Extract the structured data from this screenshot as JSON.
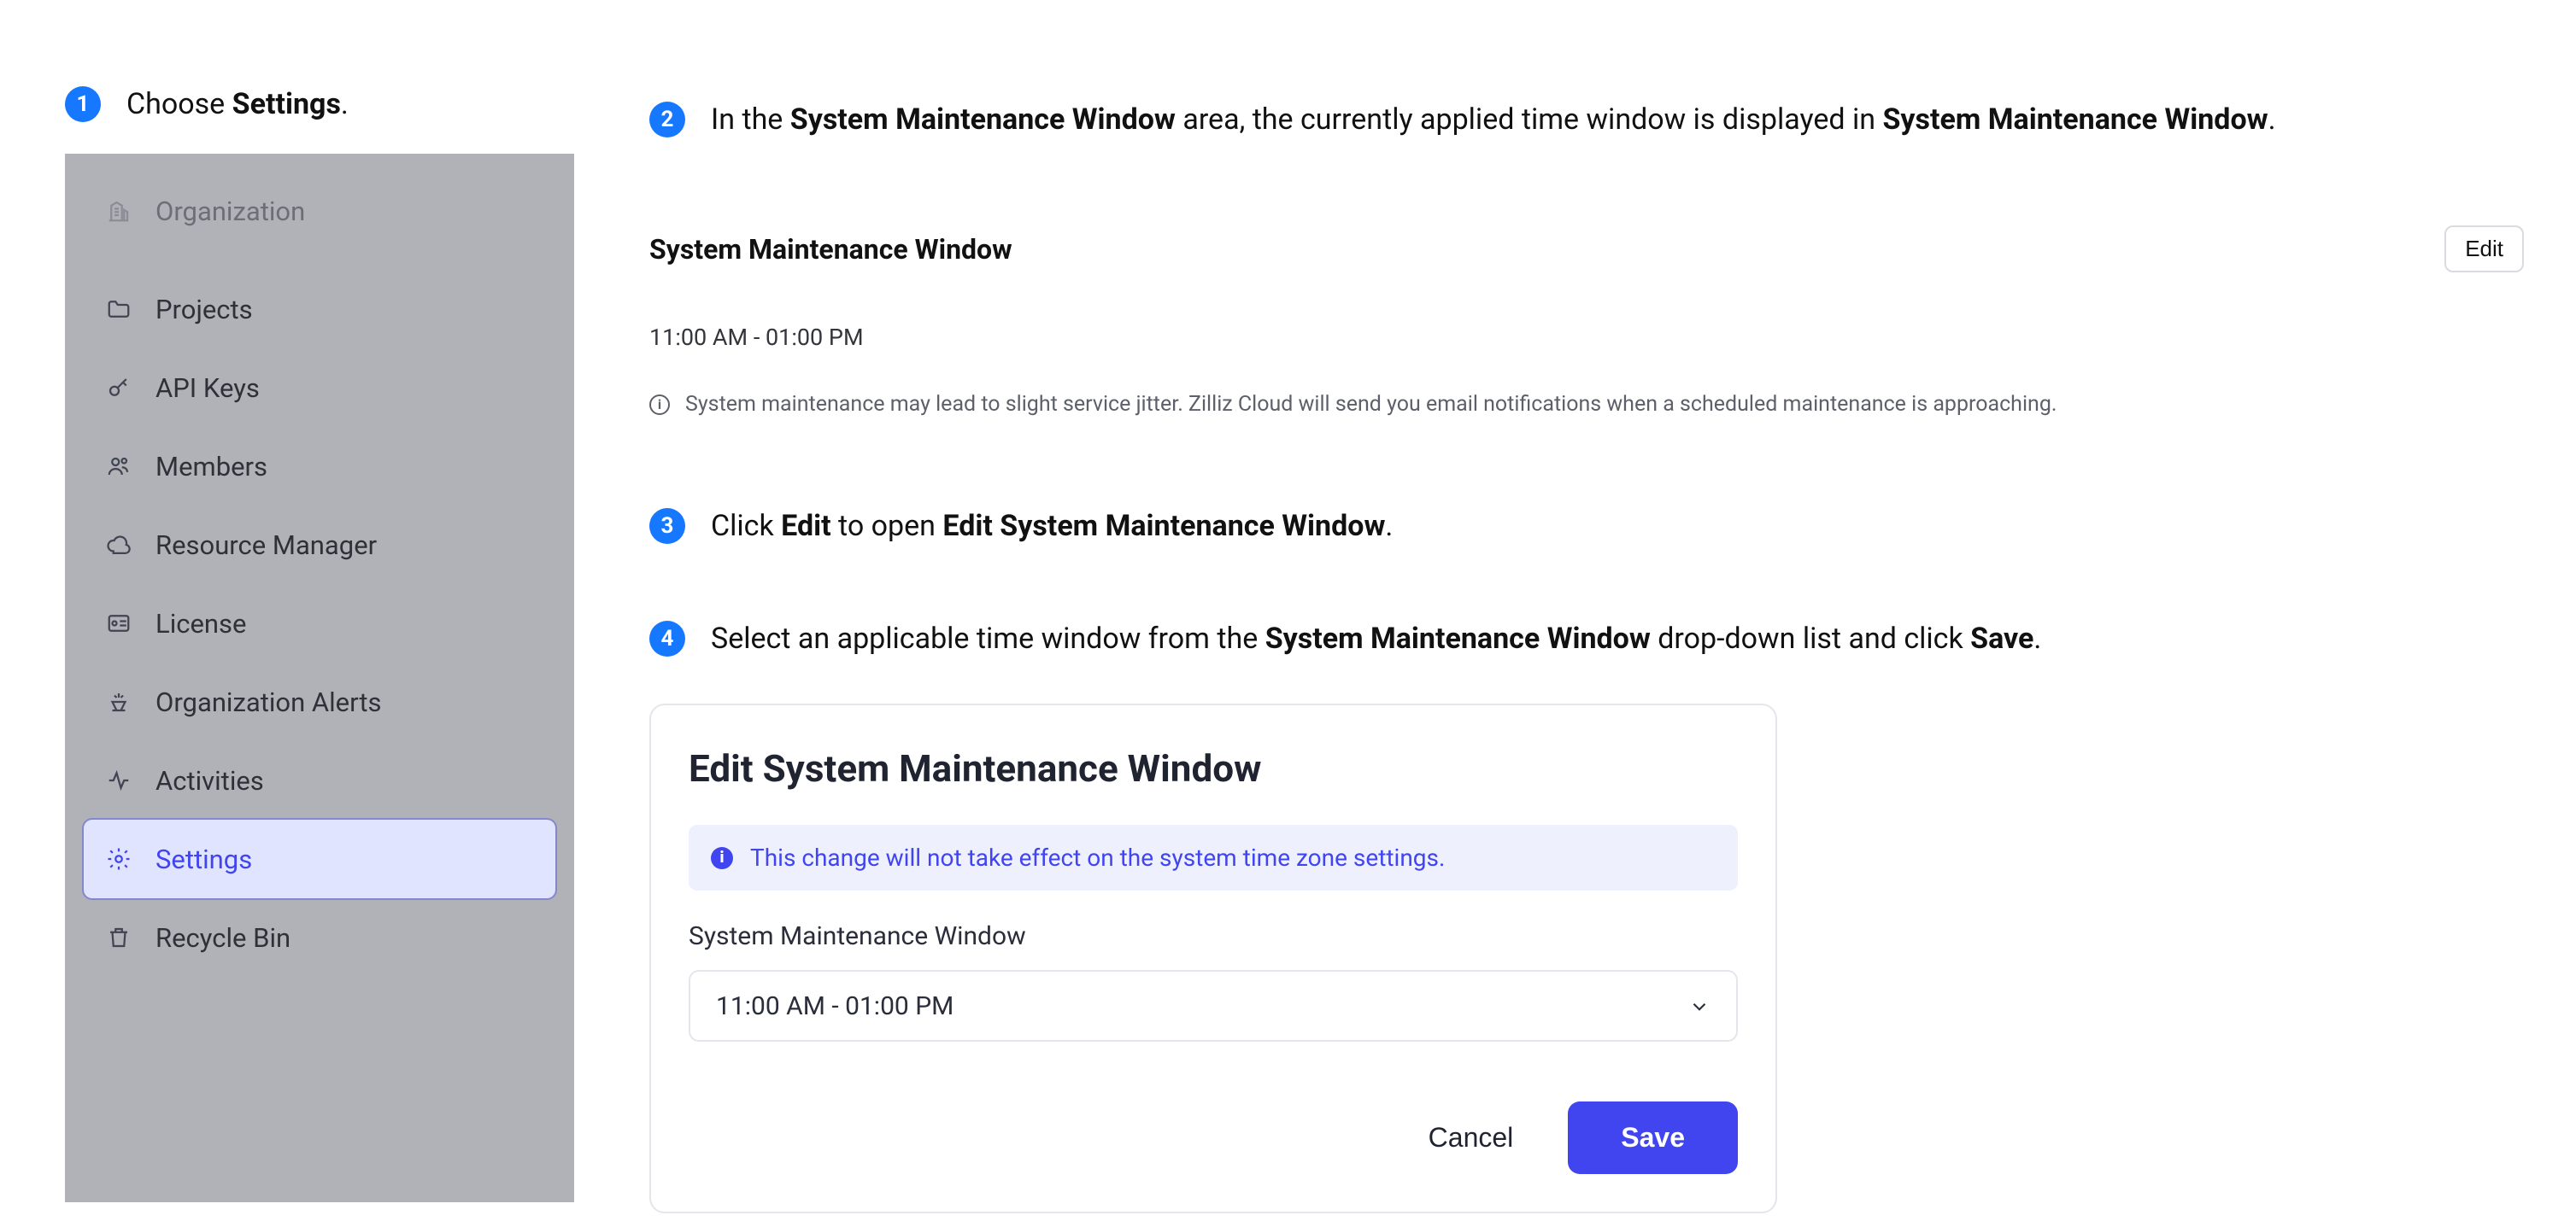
{
  "steps": {
    "s1_pre": "Choose ",
    "s1_bold": "Settings",
    "s1_post": ".",
    "s2_pre": "In the ",
    "s2_b1": "System Maintenance Window",
    "s2_mid": " area, the currently applied time window is displayed in ",
    "s2_b2": "System Maintenance Window",
    "s2_post": ".",
    "s3_pre": "Click ",
    "s3_b1": "Edit",
    "s3_mid": " to open ",
    "s3_b2": "Edit System Maintenance Window",
    "s3_post": ".",
    "s4_pre": "Select an applicable time window from the ",
    "s4_b1": "System Maintenance Window",
    "s4_mid": " drop-down list and click ",
    "s4_b2": "Save",
    "s4_post": "."
  },
  "badges": {
    "n1": "1",
    "n2": "2",
    "n3": "3",
    "n4": "4"
  },
  "sidebar": {
    "header": "Organization",
    "items": [
      "Projects",
      "API Keys",
      "Members",
      "Resource Manager",
      "License",
      "Organization Alerts",
      "Activities",
      "Settings",
      "Recycle Bin"
    ]
  },
  "smw": {
    "title": "System Maintenance Window",
    "edit": "Edit",
    "time": "11:00 AM - 01:00 PM",
    "note": "System maintenance may lead to slight service jitter. Zilliz Cloud will send you email notifications when a scheduled maintenance is approaching.",
    "info_glyph": "i"
  },
  "dialog": {
    "title": "Edit System Maintenance Window",
    "alert": "This change will not take effect on the system time zone settings.",
    "alert_glyph": "i",
    "label": "System Maintenance Window",
    "value": "11:00 AM - 01:00 PM",
    "cancel": "Cancel",
    "save": "Save"
  }
}
